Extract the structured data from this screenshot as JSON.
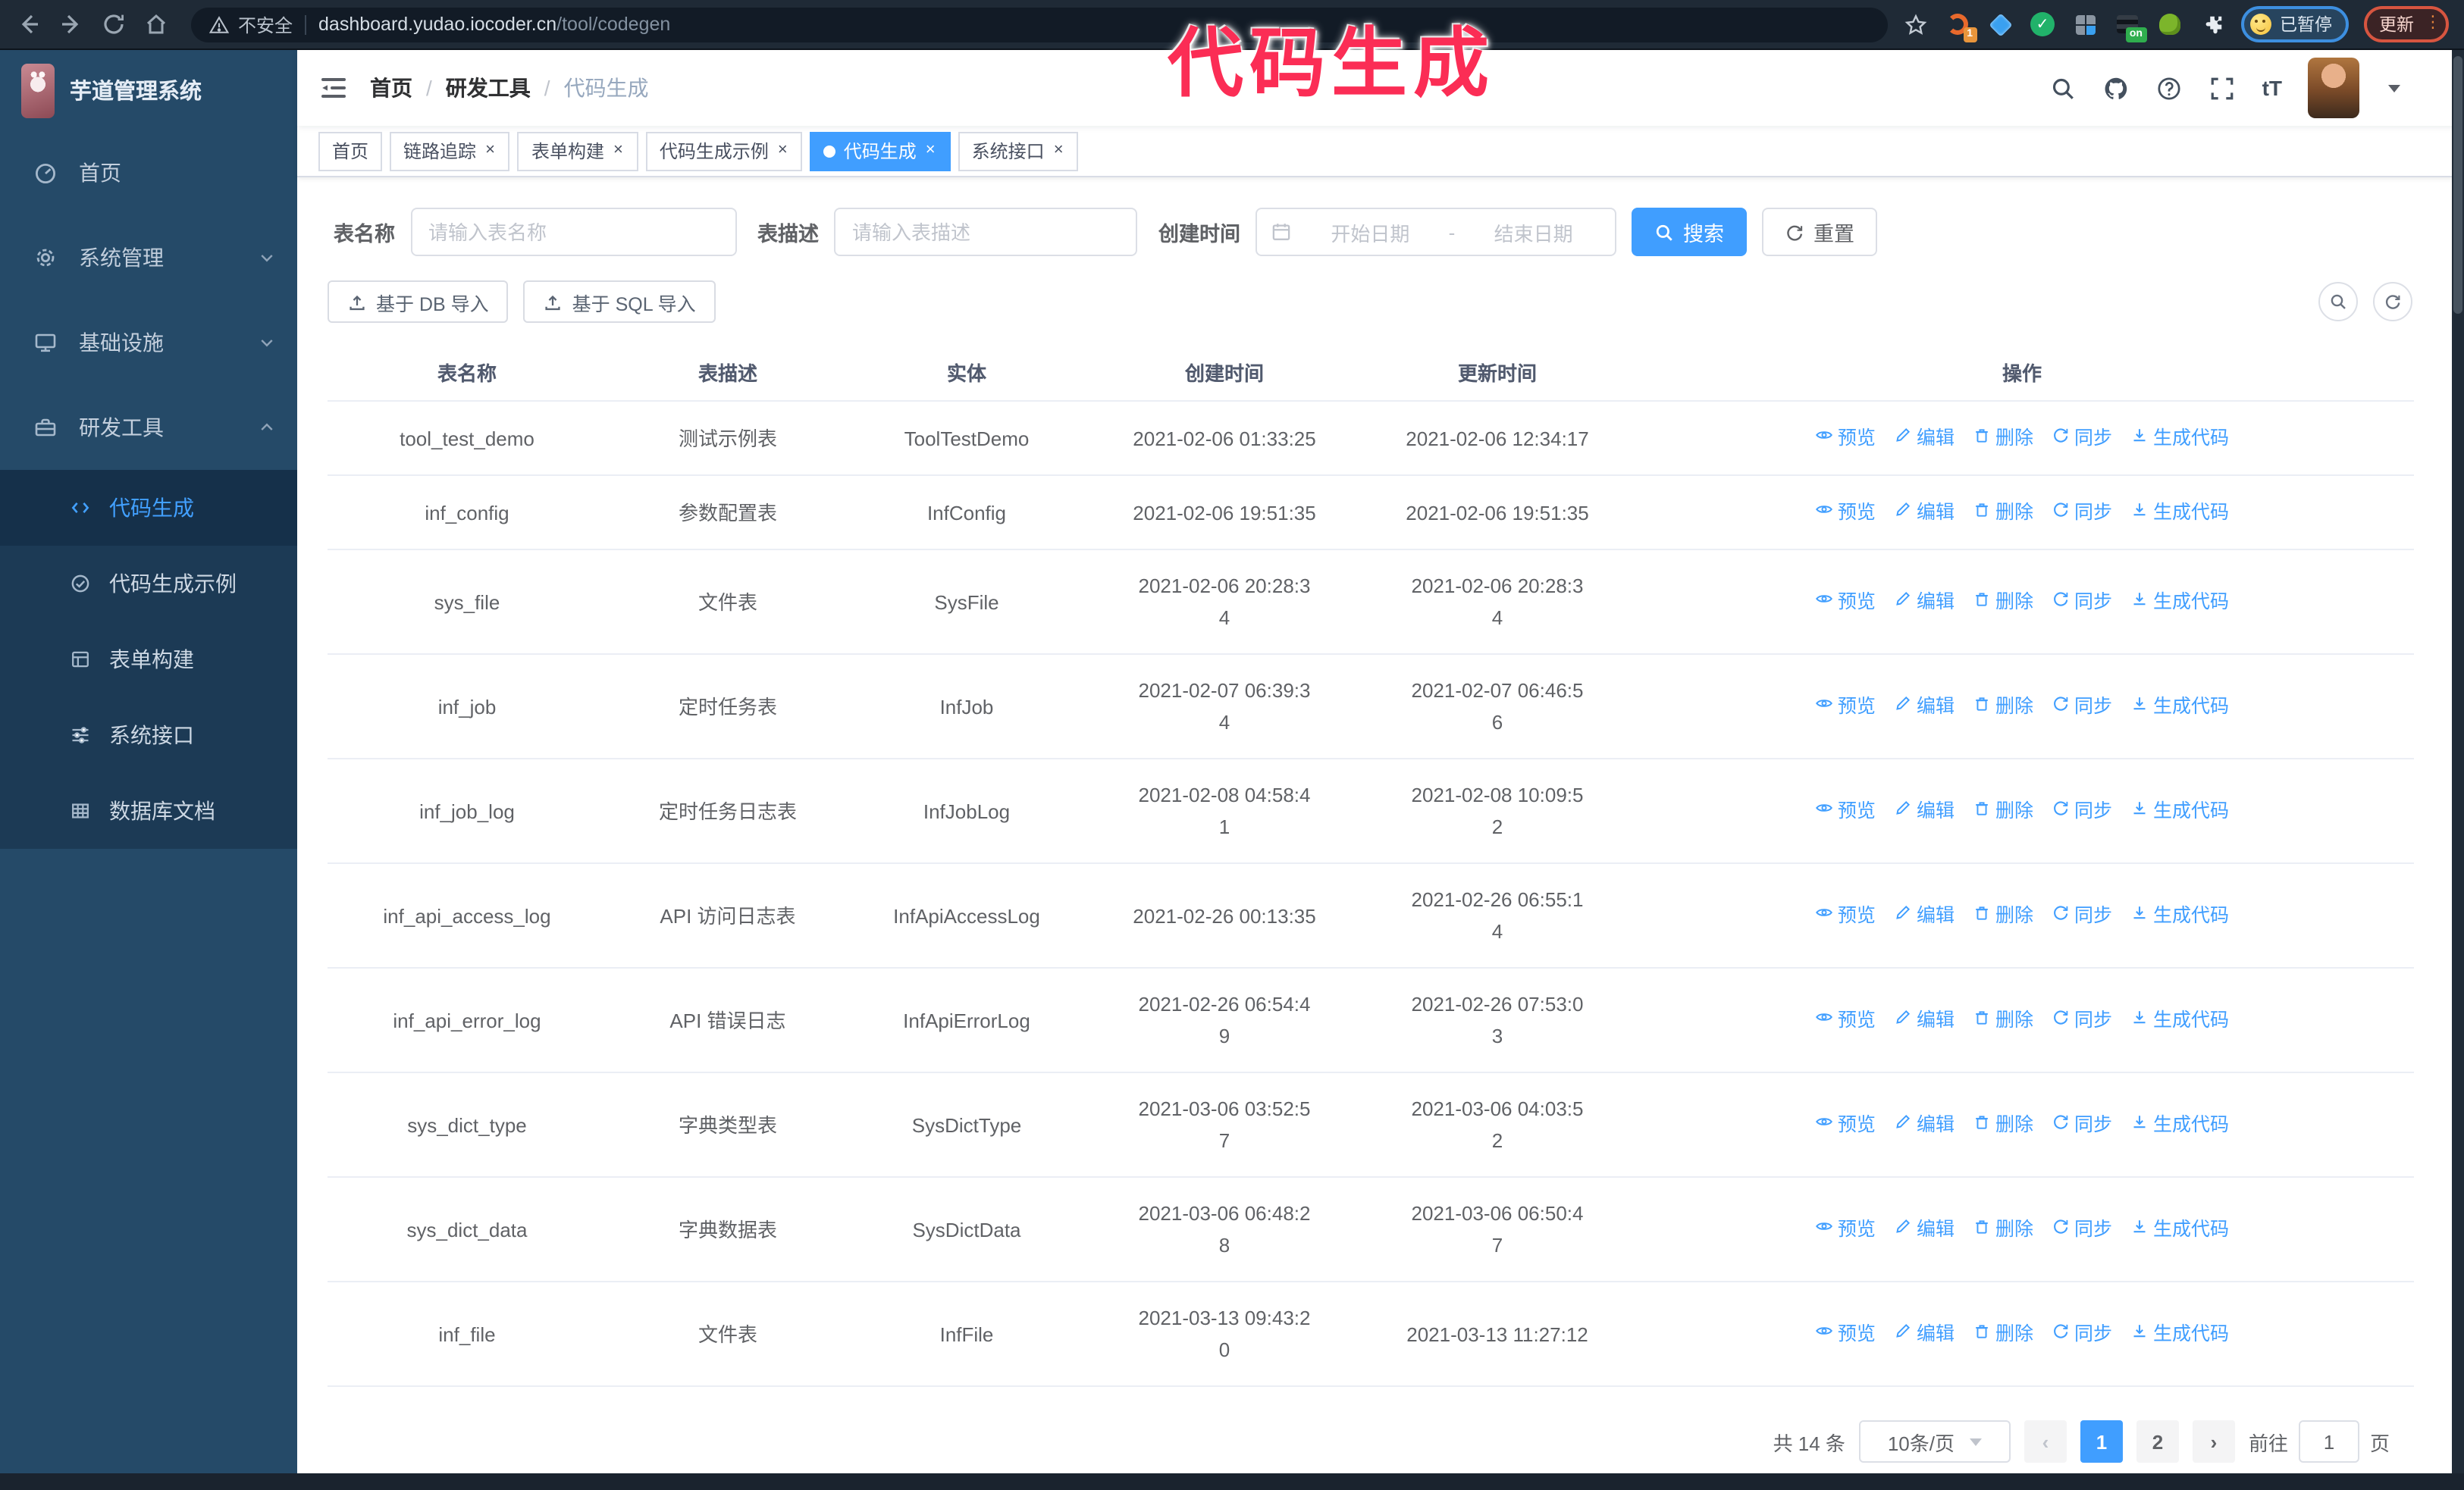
{
  "browser": {
    "security_label": "不安全",
    "url_host": "dashboard.yudao.iocoder.cn",
    "url_path": "/tool/codegen",
    "profile_label": "已暂停",
    "update_label": "更新",
    "extension_badge_1": "1",
    "extension_badge_on": "on",
    "check_glyph": "✓",
    "menu_dots": "⋮"
  },
  "annotation": {
    "text": "代码生成",
    "color": "#fb2d55"
  },
  "sidebar": {
    "title": "芋道管理系统",
    "items": [
      {
        "label": "首页",
        "icon": "dashboard-icon",
        "chevron": "none"
      },
      {
        "label": "系统管理",
        "icon": "gear-icon",
        "chevron": "down"
      },
      {
        "label": "基础设施",
        "icon": "monitor-icon",
        "chevron": "down"
      },
      {
        "label": "研发工具",
        "icon": "toolbox-icon",
        "chevron": "up"
      }
    ],
    "subitems": [
      {
        "label": "代码生成",
        "icon": "code-icon",
        "active": true
      },
      {
        "label": "代码生成示例",
        "icon": "example-icon",
        "active": false
      },
      {
        "label": "表单构建",
        "icon": "form-icon",
        "active": false
      },
      {
        "label": "系统接口",
        "icon": "api-icon",
        "active": false
      },
      {
        "label": "数据库文档",
        "icon": "database-icon",
        "active": false
      }
    ]
  },
  "header": {
    "breadcrumb": [
      "首页",
      "研发工具",
      "代码生成"
    ],
    "separator": "/"
  },
  "tabs": [
    {
      "label": "首页",
      "closable": false,
      "active": false
    },
    {
      "label": "链路追踪",
      "closable": true,
      "active": false
    },
    {
      "label": "表单构建",
      "closable": true,
      "active": false
    },
    {
      "label": "代码生成示例",
      "closable": true,
      "active": false
    },
    {
      "label": "代码生成",
      "closable": true,
      "active": true
    },
    {
      "label": "系统接口",
      "closable": true,
      "active": false
    }
  ],
  "filters": {
    "name_label": "表名称",
    "name_placeholder": "请输入表名称",
    "desc_label": "表描述",
    "desc_placeholder": "请输入表描述",
    "time_label": "创建时间",
    "start_placeholder": "开始日期",
    "range_separator": "-",
    "end_placeholder": "结束日期",
    "search_label": "搜索",
    "reset_label": "重置"
  },
  "toolbar": {
    "import_db_label": "基于 DB 导入",
    "import_sql_label": "基于 SQL 导入"
  },
  "table": {
    "headers": [
      "表名称",
      "表描述",
      "实体",
      "创建时间",
      "更新时间",
      "操作"
    ],
    "actions": [
      "预览",
      "编辑",
      "删除",
      "同步",
      "生成代码"
    ],
    "action_icons": [
      "eye-icon",
      "edit-icon",
      "delete-icon",
      "sync-icon",
      "download-icon"
    ],
    "rows": [
      {
        "name": "tool_test_demo",
        "desc": "测试示例表",
        "entity": "ToolTestDemo",
        "created": "2021-02-06 01:33:25",
        "updated": "2021-02-06 12:34:17"
      },
      {
        "name": "inf_config",
        "desc": "参数配置表",
        "entity": "InfConfig",
        "created": "2021-02-06 19:51:35",
        "updated": "2021-02-06 19:51:35"
      },
      {
        "name": "sys_file",
        "desc": "文件表",
        "entity": "SysFile",
        "created": [
          "2021-02-06 20:28:3",
          "4"
        ],
        "updated": [
          "2021-02-06 20:28:3",
          "4"
        ]
      },
      {
        "name": "inf_job",
        "desc": "定时任务表",
        "entity": "InfJob",
        "created": [
          "2021-02-07 06:39:3",
          "4"
        ],
        "updated": [
          "2021-02-07 06:46:5",
          "6"
        ]
      },
      {
        "name": "inf_job_log",
        "desc": "定时任务日志表",
        "entity": "InfJobLog",
        "created": [
          "2021-02-08 04:58:4",
          "1"
        ],
        "updated": [
          "2021-02-08 10:09:5",
          "2"
        ]
      },
      {
        "name": "inf_api_access_log",
        "desc": "API 访问日志表",
        "entity": "InfApiAccessLog",
        "created": "2021-02-26 00:13:35",
        "updated": [
          "2021-02-26 06:55:1",
          "4"
        ]
      },
      {
        "name": "inf_api_error_log",
        "desc": "API 错误日志",
        "entity": "InfApiErrorLog",
        "created": [
          "2021-02-26 06:54:4",
          "9"
        ],
        "updated": [
          "2021-02-26 07:53:0",
          "3"
        ]
      },
      {
        "name": "sys_dict_type",
        "desc": "字典类型表",
        "entity": "SysDictType",
        "created": [
          "2021-03-06 03:52:5",
          "7"
        ],
        "updated": [
          "2021-03-06 04:03:5",
          "2"
        ]
      },
      {
        "name": "sys_dict_data",
        "desc": "字典数据表",
        "entity": "SysDictData",
        "created": [
          "2021-03-06 06:48:2",
          "8"
        ],
        "updated": [
          "2021-03-06 06:50:4",
          "7"
        ]
      },
      {
        "name": "inf_file",
        "desc": "文件表",
        "entity": "InfFile",
        "created": [
          "2021-03-13 09:43:2",
          "0"
        ],
        "updated": "2021-03-13 11:27:12"
      }
    ]
  },
  "pagination": {
    "total_label": "共 14 条",
    "page_size_label": "10条/页",
    "prev_glyph": "‹",
    "next_glyph": "›",
    "pages": [
      "1",
      "2"
    ],
    "active_page": "1",
    "goto_label": "前往",
    "goto_value": "1",
    "page_unit": "页"
  }
}
